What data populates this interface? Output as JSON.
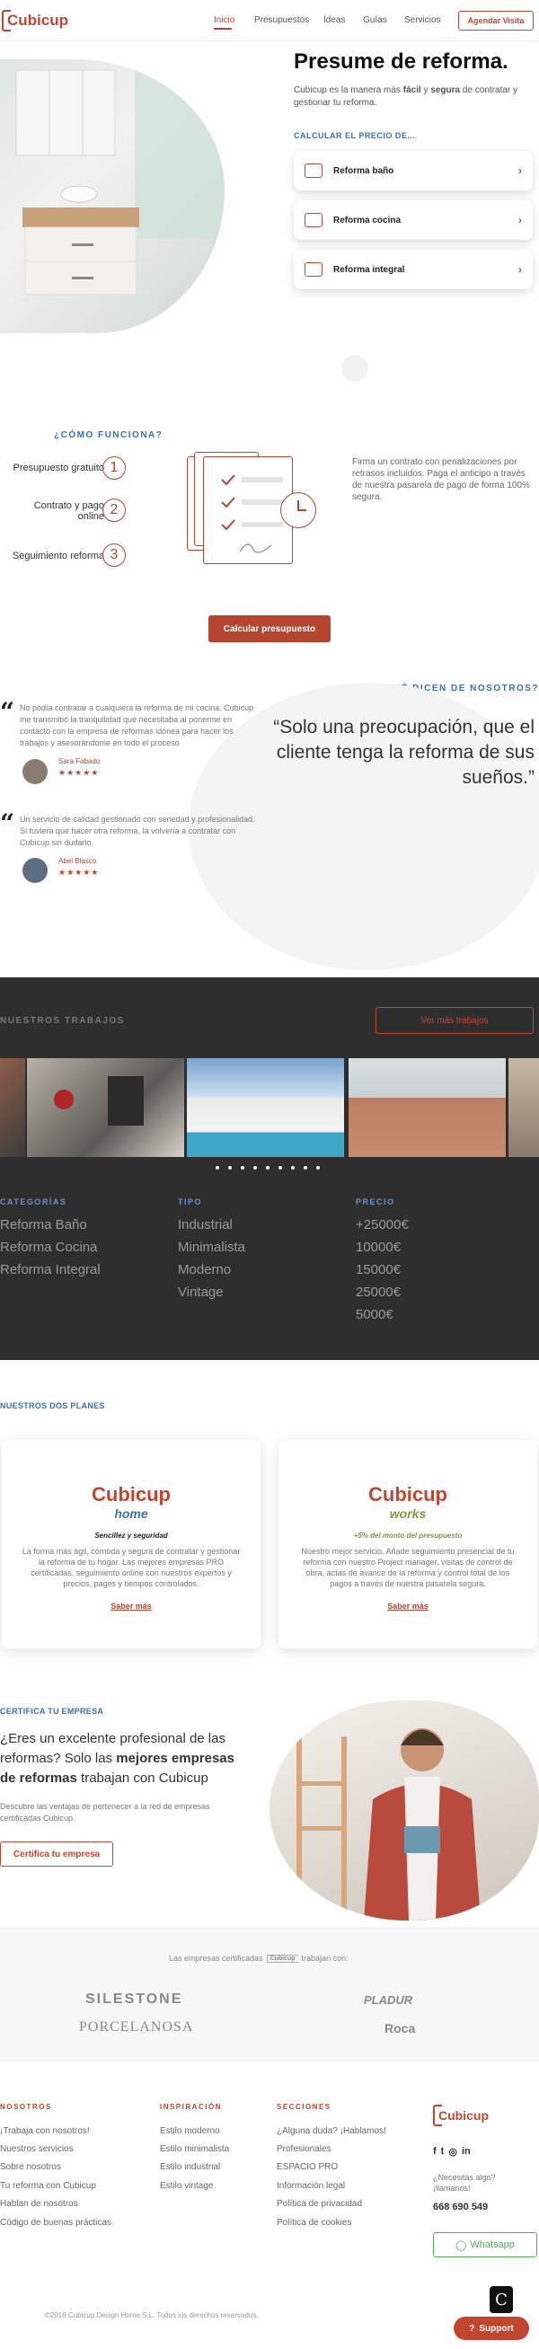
{
  "header": {
    "logo": "Cubicup",
    "nav": [
      "Inicio",
      "Presupuestos",
      "Ideas",
      "Guías",
      "Servicios"
    ],
    "cta": "Agendar Visita"
  },
  "hero": {
    "title": "Presume de reforma.",
    "subtitle_part1": "Cubicup es la manera más ",
    "subtitle_bold1": "fácil",
    "subtitle_part2": " y ",
    "subtitle_bold2": "segura",
    "subtitle_part3": " de contratar y gestionar tu reforma.",
    "calc_label": "CALCULAR EL PRECIO DE...",
    "cards": [
      {
        "label": "Reforma baño",
        "icon": "bathtub-icon"
      },
      {
        "label": "Reforma cocina",
        "icon": "kitchen-icon"
      },
      {
        "label": "Reforma integral",
        "icon": "house-icon"
      }
    ]
  },
  "how": {
    "label": "¿CÓMO FUNCIONA?",
    "steps": [
      {
        "text": "Presupuesto gratuito",
        "num": "1"
      },
      {
        "text": "Contrato y pago online",
        "num": "2"
      },
      {
        "text": "Seguimiento reforma",
        "num": "3"
      }
    ],
    "description": "Firma un contrato con penalizaciones por retrasos incluidos. Paga el anticipo a través de nuestra pasarela de pago de forma 100% segura.",
    "cta": "Calcular presupuesto"
  },
  "testimonials": {
    "label": "¿QUÉ DICEN DE NOSOTROS?",
    "items": [
      {
        "text": "No podía contratar a cualquiera la reforma de mi cocina. Cubicup me transmitió la tranquilidad que necesitaba al ponerme en contacto con la empresa de reformas idónea para hacer los trabajos y asesorándome en todo el proceso",
        "name": "Sara Fabado",
        "stars": "★★★★★"
      },
      {
        "text": "Un servicio de calidad gestionado con seriedad y profesionalidad. Si tuviera que hacer otra reforma, la volvería a contratar con Cubicup sin dudarlo.",
        "name": "Abel Blasco",
        "stars": "★★★★★"
      }
    ],
    "quote": "“Solo una preocupación, que el cliente tenga la reforma de sus sueños.”"
  },
  "works": {
    "label": "NUESTROS TRABAJOS",
    "cta": "Ver más trabajos",
    "columns": [
      {
        "head": "CATEGORÍAS",
        "items": [
          "Reforma Baño",
          "Reforma Cocina",
          "Reforma Integral"
        ]
      },
      {
        "head": "TIPO",
        "items": [
          "Industrial",
          "Minimalista",
          "Moderno",
          "Vintage"
        ]
      },
      {
        "head": "PRECIO",
        "items": [
          "+25000€",
          "10000€",
          "15000€",
          "25000€",
          "5000€"
        ]
      }
    ]
  },
  "plans": {
    "label": "NUESTROS DOS PLANES",
    "items": [
      {
        "brand": "Cubicup",
        "sub": "home",
        "tag": "Sencillez y seguridad",
        "desc": "La forma más ágil, cómoda y segura de contratar y gestionar la reforma de tu hogar. Las mejores empresas PRO certificadas, seguimiento online con nuestros expertos y precios, pagos y tiempos controlados.",
        "link": "Saber más"
      },
      {
        "brand": "Cubicup",
        "sub": "works",
        "tag": "+5% del monto del presupuesto",
        "desc": "Nuestro mejor servicio. Añade seguimiento presencial de tu reforma con nuestro Project manager, visitas de control de obra, actas de avance de la reforma y control total de los pagos a través de nuestra pasarela segura.",
        "link": "Saber más"
      }
    ]
  },
  "pro": {
    "label": "CERTIFICA TU EMPRESA",
    "title_part1": "¿Eres un excelente profesional de las reformas? Solo las ",
    "title_bold": "mejores empresas de reformas",
    "title_part2": " trabajan con Cubicup",
    "desc": "Descubre las ventajas de pertenecer a la red de empresas certificadas Cubicup.",
    "cta": "Certifica tu empresa"
  },
  "brands": {
    "intro_part1": "Las empresas certificadas",
    "intro_part2": "trabajan con:",
    "mini_logo": "Cubicup",
    "items": [
      "SILESTONE",
      "PLADUR",
      "PORCELANOSA",
      "Roca"
    ]
  },
  "footer": {
    "cols": [
      {
        "head": "NOSOTROS",
        "links": [
          "¡Trabaja con nosotros!",
          "Nuestros servicios",
          "Sobre nosotros",
          "Tu reforma con Cubicup",
          "Hablan de nosotros",
          "Código de buenas prácticas"
        ]
      },
      {
        "head": "INSPIRACIÓN",
        "links": [
          "Estilo moderno",
          "Estilo minimalista",
          "Estilo industrial",
          "Estilo vintage"
        ]
      },
      {
        "head": "SECCIONES",
        "links": [
          "¿Alguna duda? ¡Hablamos!",
          "Profesionales",
          "ESPACIO PRO",
          "Información legal",
          "Política de privacidad",
          "Política de cookies"
        ]
      }
    ],
    "logo": "Cubicup",
    "help": "¿Necesitas algo? ¡llámanos!",
    "phone": "668 690 549",
    "whatsapp": "Whatsapp",
    "copyright": "©2018 Cubicup Design Home S.L. Todos los derechos reservados.",
    "support": "Support"
  }
}
